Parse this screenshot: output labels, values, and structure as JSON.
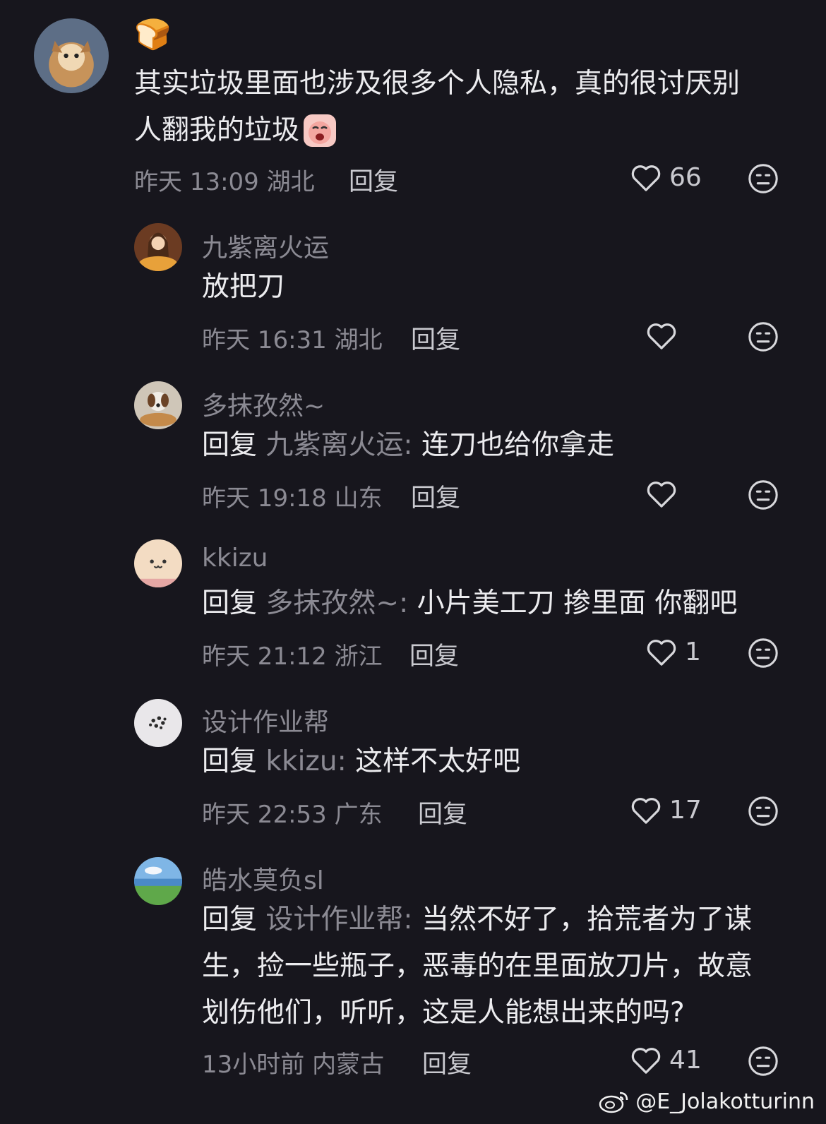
{
  "comments": [
    {
      "username": "🍞",
      "text_lines": [
        "其实垃圾里面也涉及很多个人隐私，真的很讨厌别",
        "人翻我的垃圾"
      ],
      "time": "昨天 13:09",
      "location": "湖北",
      "reply_label": "回复",
      "likes": "66"
    },
    {
      "username": "九紫离火运",
      "text": "放把刀",
      "time": "昨天 16:31",
      "location": "湖北",
      "reply_label": "回复",
      "likes": ""
    },
    {
      "username": "多抹孜然~",
      "reply_prefix": "回复",
      "reply_to": "九紫离火运:",
      "text": " 连刀也给你拿走",
      "time": "昨天 19:18",
      "location": "山东",
      "reply_label": "回复",
      "likes": ""
    },
    {
      "username": "kkizu",
      "reply_prefix": "回复",
      "reply_to": "多抹孜然~:",
      "text": " 小片美工刀 掺里面  你翻吧",
      "time": "昨天 21:12",
      "location": "浙江",
      "reply_label": "回复",
      "likes": "1"
    },
    {
      "username": "设计作业帮",
      "reply_prefix": "回复",
      "reply_to": "kkizu:",
      "text": " 这样不太好吧",
      "time": "昨天 22:53",
      "location": "广东",
      "reply_label": "回复",
      "likes": "17"
    },
    {
      "username": "皓水莫负sl",
      "reply_prefix": "回复",
      "reply_to": "设计作业帮:",
      "text": " 当然不好了，拾荒者为了谋",
      "text_lines": [
        "生，捡一些瓶子，恶毒的在里面放刀片，故意",
        "划伤他们，听听，这是人能想出来的吗?"
      ],
      "time": "13小时前",
      "location": "内蒙古",
      "reply_label": "回复",
      "likes": "41"
    }
  ],
  "icons": {
    "like": "heart-outline-icon",
    "dislike": "meh-face-icon",
    "weibo": "weibo-logo-icon"
  },
  "watermark": "@E_Jolakotturinn"
}
